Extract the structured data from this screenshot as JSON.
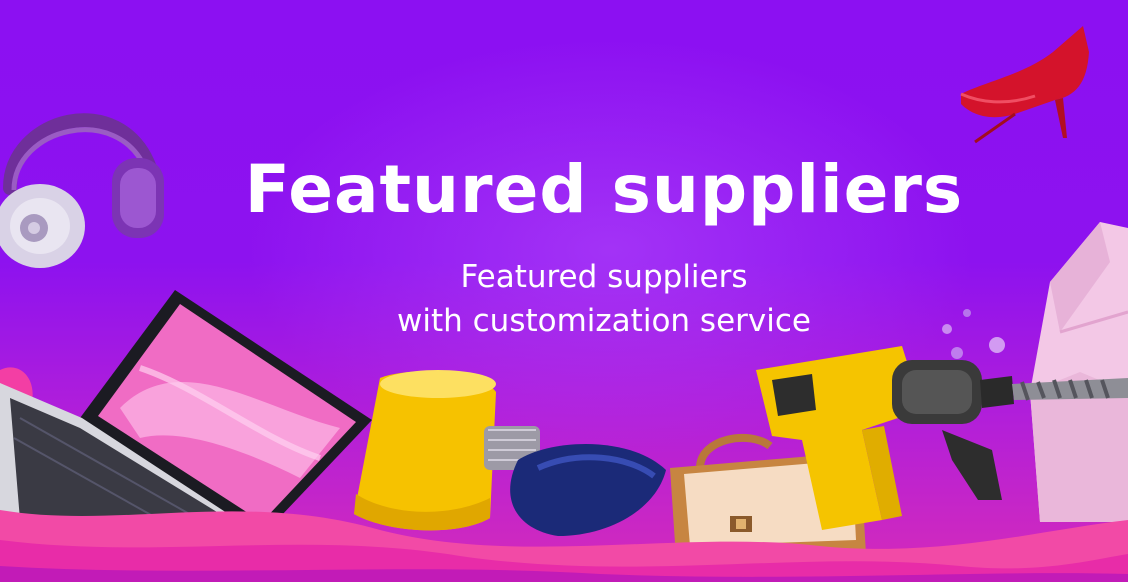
{
  "banner": {
    "title": "Featured suppliers",
    "subtitle_line1": "Featured suppliers",
    "subtitle_line2": "with customization service"
  },
  "images": [
    {
      "name": "headphones",
      "icon": "headphones-icon"
    },
    {
      "name": "high-heel-shoe",
      "icon": "high-heel-icon"
    },
    {
      "name": "laptop",
      "icon": "laptop-icon"
    },
    {
      "name": "lamp",
      "icon": "lamp-icon"
    },
    {
      "name": "hair-dryer",
      "icon": "hair-dryer-icon"
    },
    {
      "name": "handbag",
      "icon": "handbag-icon"
    },
    {
      "name": "power-drill",
      "icon": "drill-icon"
    },
    {
      "name": "fabric-roll",
      "icon": "fabric-icon"
    }
  ],
  "colors": {
    "background": "#8c10f2",
    "accent_pink": "#e82ca8",
    "text": "#ffffff"
  }
}
